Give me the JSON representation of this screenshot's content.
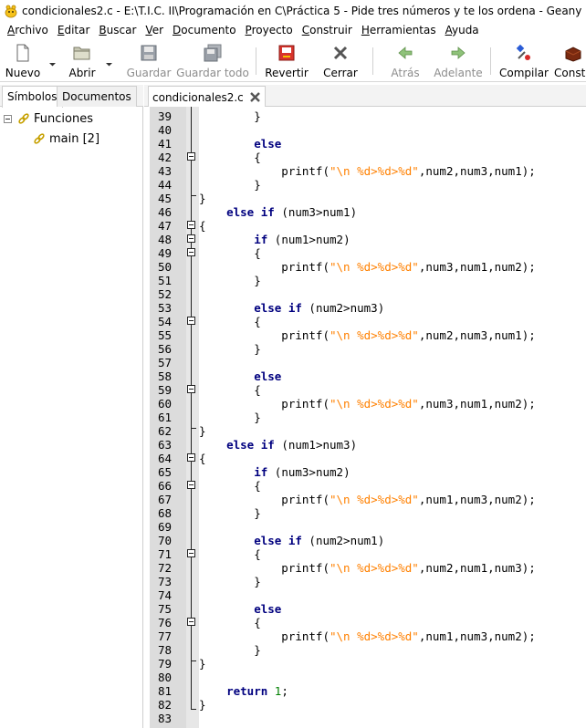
{
  "window": {
    "title": "condicionales2.c - E:\\T.I.C. II\\Programación en C\\Práctica 5 - Pide tres números y te los ordena - Geany"
  },
  "menu": [
    {
      "mnemonic": "A",
      "rest": "rchivo"
    },
    {
      "mnemonic": "E",
      "rest": "ditar"
    },
    {
      "mnemonic": "B",
      "rest": "uscar"
    },
    {
      "mnemonic": "V",
      "rest": "er"
    },
    {
      "mnemonic": "D",
      "rest": "ocumento"
    },
    {
      "mnemonic": "P",
      "rest": "royecto"
    },
    {
      "mnemonic": "C",
      "rest": "onstruir"
    },
    {
      "mnemonic": "H",
      "rest": "erramientas"
    },
    {
      "mnemonic": "A",
      "rest": "yuda"
    }
  ],
  "toolbar": {
    "new_label": "Nuevo",
    "open_label": "Abrir",
    "save_label": "Guardar",
    "save_all_label": "Guardar todo",
    "revert_label": "Revertir",
    "close_label": "Cerrar",
    "back_label": "Atrás",
    "forward_label": "Adelante",
    "compile_label": "Compilar",
    "build_label": "Constr"
  },
  "sidebar": {
    "tabs": [
      "Símbolos",
      "Documentos"
    ],
    "active_tab": "Símbolos",
    "tree": {
      "group_label": "Funciones",
      "item_label": "main [2]"
    }
  },
  "editor": {
    "tab_label": "condicionales2.c",
    "colors": {
      "keyword": "#00007f",
      "string": "#ff8000",
      "number": "#007f00",
      "gutter": "#dcdcdc"
    },
    "lines": [
      {
        "n": "39",
        "code": [
          {
            "t": "        }"
          }
        ]
      },
      {
        "n": "40",
        "code": []
      },
      {
        "n": "41",
        "code": [
          {
            "t": "        "
          },
          {
            "t": "else",
            "c": "kw"
          }
        ]
      },
      {
        "n": "42",
        "code": [
          {
            "t": "        {"
          }
        ]
      },
      {
        "n": "43",
        "code": [
          {
            "t": "            printf("
          },
          {
            "t": "\"\\n %d>%d>%d\"",
            "c": "str"
          },
          {
            "t": ",num2,num3,num1);"
          }
        ]
      },
      {
        "n": "44",
        "code": [
          {
            "t": "        }"
          }
        ]
      },
      {
        "n": "45",
        "code": [
          {
            "t": "}"
          }
        ]
      },
      {
        "n": "46",
        "code": [
          {
            "t": "    "
          },
          {
            "t": "else if",
            "c": "kw"
          },
          {
            "t": " (num3>num1)"
          }
        ]
      },
      {
        "n": "47",
        "code": [
          {
            "t": "{"
          }
        ]
      },
      {
        "n": "48",
        "code": [
          {
            "t": "        "
          },
          {
            "t": "if",
            "c": "kw"
          },
          {
            "t": " (num1>num2)"
          }
        ]
      },
      {
        "n": "49",
        "code": [
          {
            "t": "        {"
          }
        ]
      },
      {
        "n": "50",
        "code": [
          {
            "t": "            printf("
          },
          {
            "t": "\"\\n %d>%d>%d\"",
            "c": "str"
          },
          {
            "t": ",num3,num1,num2);"
          }
        ]
      },
      {
        "n": "51",
        "code": [
          {
            "t": "        }"
          }
        ]
      },
      {
        "n": "52",
        "code": []
      },
      {
        "n": "53",
        "code": [
          {
            "t": "        "
          },
          {
            "t": "else if",
            "c": "kw"
          },
          {
            "t": " (num2>num3)"
          }
        ]
      },
      {
        "n": "54",
        "code": [
          {
            "t": "        {"
          }
        ]
      },
      {
        "n": "55",
        "code": [
          {
            "t": "            printf("
          },
          {
            "t": "\"\\n %d>%d>%d\"",
            "c": "str"
          },
          {
            "t": ",num2,num3,num1);"
          }
        ]
      },
      {
        "n": "56",
        "code": [
          {
            "t": "        }"
          }
        ]
      },
      {
        "n": "57",
        "code": []
      },
      {
        "n": "58",
        "code": [
          {
            "t": "        "
          },
          {
            "t": "else",
            "c": "kw"
          }
        ]
      },
      {
        "n": "59",
        "code": [
          {
            "t": "        {"
          }
        ]
      },
      {
        "n": "60",
        "code": [
          {
            "t": "            printf("
          },
          {
            "t": "\"\\n %d>%d>%d\"",
            "c": "str"
          },
          {
            "t": ",num3,num1,num2);"
          }
        ]
      },
      {
        "n": "61",
        "code": [
          {
            "t": "        }"
          }
        ]
      },
      {
        "n": "62",
        "code": [
          {
            "t": "}"
          }
        ]
      },
      {
        "n": "63",
        "code": [
          {
            "t": "    "
          },
          {
            "t": "else if",
            "c": "kw"
          },
          {
            "t": " (num1>num3)"
          }
        ]
      },
      {
        "n": "64",
        "code": [
          {
            "t": "{"
          }
        ]
      },
      {
        "n": "65",
        "code": [
          {
            "t": "        "
          },
          {
            "t": "if",
            "c": "kw"
          },
          {
            "t": " (num3>num2)"
          }
        ]
      },
      {
        "n": "66",
        "code": [
          {
            "t": "        {"
          }
        ]
      },
      {
        "n": "67",
        "code": [
          {
            "t": "            printf("
          },
          {
            "t": "\"\\n %d>%d>%d\"",
            "c": "str"
          },
          {
            "t": ",num1,num3,num2);"
          }
        ]
      },
      {
        "n": "68",
        "code": [
          {
            "t": "        }"
          }
        ]
      },
      {
        "n": "69",
        "code": []
      },
      {
        "n": "70",
        "code": [
          {
            "t": "        "
          },
          {
            "t": "else if",
            "c": "kw"
          },
          {
            "t": " (num2>num1)"
          }
        ]
      },
      {
        "n": "71",
        "code": [
          {
            "t": "        {"
          }
        ]
      },
      {
        "n": "72",
        "code": [
          {
            "t": "            printf("
          },
          {
            "t": "\"\\n %d>%d>%d\"",
            "c": "str"
          },
          {
            "t": ",num2,num1,num3);"
          }
        ]
      },
      {
        "n": "73",
        "code": [
          {
            "t": "        }"
          }
        ]
      },
      {
        "n": "74",
        "code": []
      },
      {
        "n": "75",
        "code": [
          {
            "t": "        "
          },
          {
            "t": "else",
            "c": "kw"
          }
        ]
      },
      {
        "n": "76",
        "code": [
          {
            "t": "        {"
          }
        ]
      },
      {
        "n": "77",
        "code": [
          {
            "t": "            printf("
          },
          {
            "t": "\"\\n %d>%d>%d\"",
            "c": "str"
          },
          {
            "t": ",num1,num3,num2);"
          }
        ]
      },
      {
        "n": "78",
        "code": [
          {
            "t": "        }"
          }
        ]
      },
      {
        "n": "79",
        "code": [
          {
            "t": "}"
          }
        ]
      },
      {
        "n": "80",
        "code": []
      },
      {
        "n": "81",
        "code": [
          {
            "t": "    "
          },
          {
            "t": "return",
            "c": "kw"
          },
          {
            "t": " "
          },
          {
            "t": "1",
            "c": "num"
          },
          {
            "t": ";"
          }
        ]
      },
      {
        "n": "82",
        "code": [
          {
            "t": "}"
          }
        ]
      },
      {
        "n": "83",
        "code": []
      }
    ]
  }
}
